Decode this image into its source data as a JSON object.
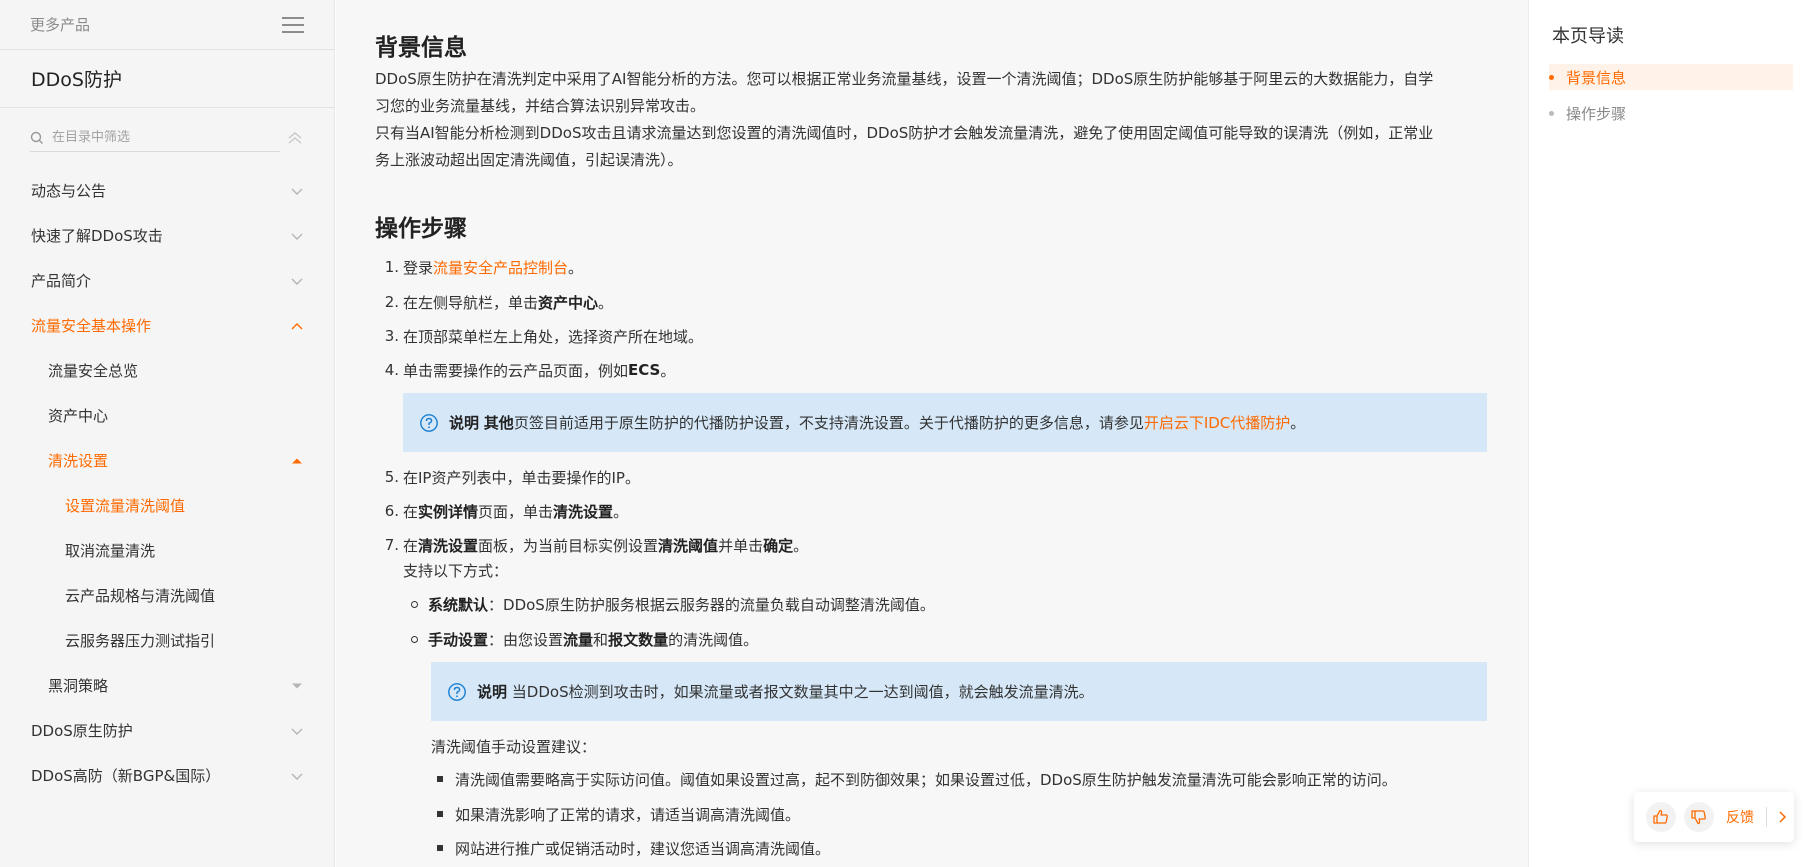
{
  "sidebar": {
    "more_products": "更多产品",
    "product_title": "DDoS防护",
    "search_placeholder": "在目录中筛选",
    "items": [
      {
        "label": "动态与公告"
      },
      {
        "label": "快速了解DDoS攻击"
      },
      {
        "label": "产品简介"
      },
      {
        "label": "流量安全基本操作"
      },
      {
        "label": "流量安全总览"
      },
      {
        "label": "资产中心"
      },
      {
        "label": "清洗设置"
      },
      {
        "label": "设置流量清洗阈值"
      },
      {
        "label": "取消流量清洗"
      },
      {
        "label": "云产品规格与清洗阈值"
      },
      {
        "label": "云服务器压力测试指引"
      },
      {
        "label": "黑洞策略"
      },
      {
        "label": "DDoS原生防护"
      },
      {
        "label": "DDoS高防（新BGP&国际）"
      }
    ]
  },
  "main": {
    "bg_heading": "背景信息",
    "bg_p1_line1": "DDoS原生防护在清洗判定中采用了AI智能分析的方法。您可以根据正常业务流量基线，设置一个清洗阈值；DDoS原生防护能够基于阿里云的大数据能力，自学",
    "bg_p1_line2": "习您的业务流量基线，并结合算法识别异常攻击。",
    "bg_p2_line1": "只有当AI智能分析检测到DDoS攻击且请求流量达到您设置的清洗阈值时，DDoS防护才会触发流量清洗，避免了使用固定阈值可能导致的误清洗（例如，正常业",
    "bg_p2_line2": "务上涨波动超出固定清洗阈值，引起误清洗）。",
    "steps_heading": "操作步骤",
    "step1": {
      "num": "1.",
      "pre": "登录",
      "link": "流量安全产品控制台",
      "post": "。"
    },
    "step2": {
      "num": "2.",
      "pre": "在左侧导航栏，单击",
      "bold": "资产中心",
      "post": "。"
    },
    "step3": {
      "num": "3.",
      "text": "在顶部菜单栏左上角处，选择资产所在地域。"
    },
    "step4": {
      "num": "4.",
      "pre": "单击需要操作的云产品页面，例如",
      "bold": "ECS",
      "post": "。"
    },
    "note1": {
      "label": "说明",
      "bold": "其他",
      "text": "页签目前适用于原生防护的代播防护设置，不支持清洗设置。关于代播防护的更多信息，请参见",
      "link": "开启云下IDC代播防护",
      "post": "。"
    },
    "step5": {
      "num": "5.",
      "text": "在IP资产列表中，单击要操作的IP。"
    },
    "step6": {
      "num": "6.",
      "pre": "在",
      "bold1": "实例详情",
      "mid": "页面，单击",
      "bold2": "清洗设置",
      "post": "。"
    },
    "step7": {
      "num": "7.",
      "pre": "在",
      "bold1": "清洗设置",
      "mid1": "面板，为当前目标实例设置",
      "bold2": "清洗阈值",
      "mid2": "并单击",
      "bold3": "确定",
      "post": "。"
    },
    "step7_sub": "支持以下方式：",
    "opt1": {
      "bold": "系统默认",
      "text": "：DDoS原生防护服务根据云服务器的流量负载自动调整清洗阈值。"
    },
    "opt2": {
      "bold": "手动设置",
      "pre": "：由您设置",
      "bold2": "流量",
      "mid": "和",
      "bold3": "报文数量",
      "post": "的清洗阈值。"
    },
    "note2": {
      "label": "说明",
      "text": "当DDoS检测到攻击时，如果流量或者报文数量其中之一达到阈值，就会触发流量清洗。"
    },
    "manual_title": "清洗阈值手动设置建议：",
    "tips": [
      "清洗阈值需要略高于实际访问值。阈值如果设置过高，起不到防御效果；如果设置过低，DDoS原生防护触发流量清洗可能会影响正常的访问。",
      "如果清洗影响了正常的请求，请适当调高清洗阈值。",
      "网站进行推广或促销活动时，建议您适当调高清洗阈值。"
    ]
  },
  "toc": {
    "title": "本页导读",
    "items": [
      "背景信息",
      "操作步骤"
    ]
  },
  "feedback": {
    "label": "反馈"
  },
  "colors": {
    "accent": "#ff6a00",
    "note_bg": "#d6e8f8",
    "note_icon": "#1b7fd1"
  }
}
